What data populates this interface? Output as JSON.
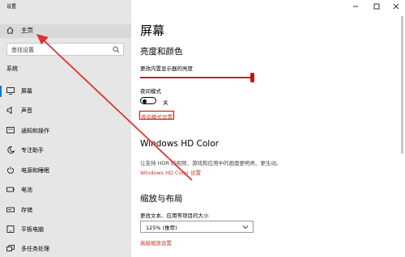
{
  "app": {
    "title": "设置"
  },
  "sidebar": {
    "home_label": "主页",
    "search_placeholder": "查找设置",
    "section_label": "系统",
    "items": [
      {
        "label": "屏幕",
        "icon": "monitor-icon"
      },
      {
        "label": "声音",
        "icon": "speaker-icon"
      },
      {
        "label": "通知和操作",
        "icon": "notification-icon"
      },
      {
        "label": "专注助手",
        "icon": "moon-icon"
      },
      {
        "label": "电源和睡眠",
        "icon": "power-icon"
      },
      {
        "label": "电池",
        "icon": "battery-icon"
      },
      {
        "label": "存储",
        "icon": "storage-icon"
      },
      {
        "label": "平板电脑",
        "icon": "tablet-icon"
      },
      {
        "label": "多任务处理",
        "icon": "multitask-icon"
      }
    ]
  },
  "main": {
    "title": "屏幕",
    "brightness": {
      "heading": "亮度和颜色",
      "slider_label": "更改内置显示器的亮度",
      "level_percent": 100
    },
    "night_light": {
      "label": "夜间模式",
      "state_label": "关",
      "settings_link": "夜间模式设置"
    },
    "hd_color": {
      "heading": "Windows HD Color",
      "description": "让支持 HDR 的视频、游戏和应用中的画面更明亮、更生动。",
      "link": "Windows HD Color 设置"
    },
    "scale_layout": {
      "heading": "缩放与布局",
      "label": "更改文本、应用等项目的大小",
      "dropdown_value": "125% (推荐)",
      "advanced_link": "高级缩放设置"
    }
  },
  "colors": {
    "accent": "#0078d7",
    "link": "#c0392b",
    "annotation": "#e03030"
  }
}
